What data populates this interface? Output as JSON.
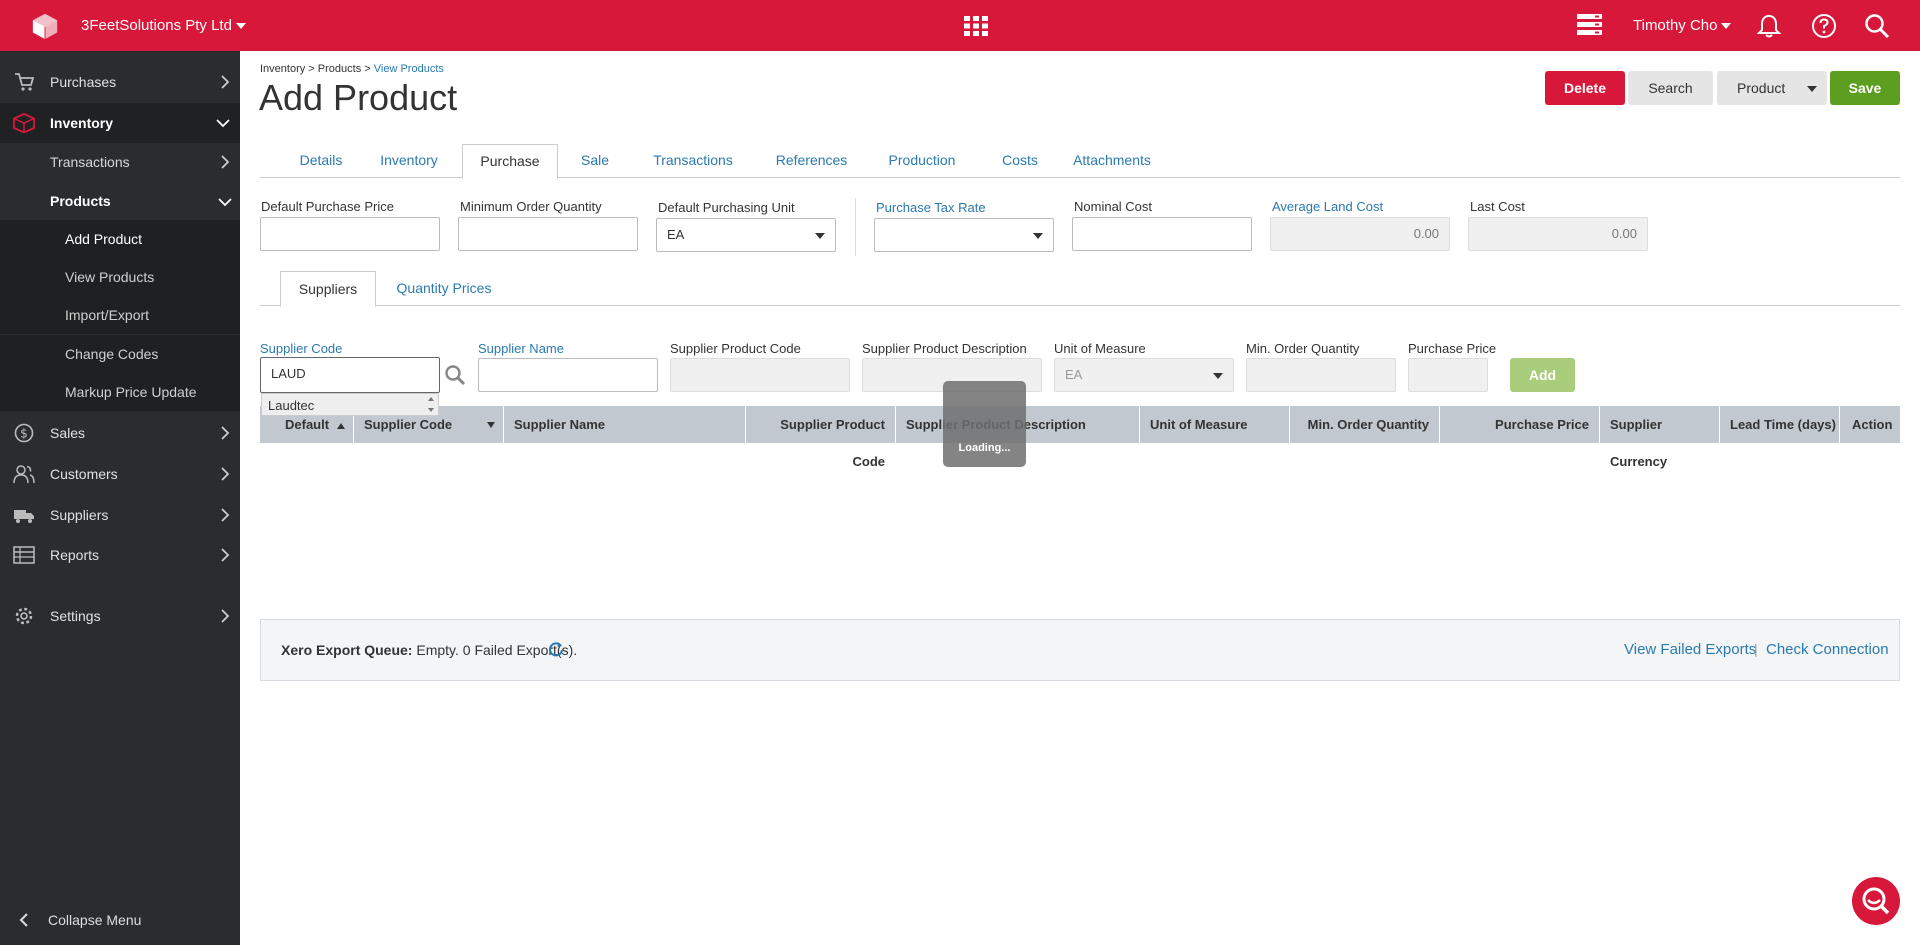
{
  "topbar": {
    "company": "3FeetSolutions Pty Ltd",
    "user": "Timothy Cho"
  },
  "sidebar": {
    "items": [
      {
        "label": "Purchases",
        "icon": "cart-icon"
      },
      {
        "label": "Inventory",
        "icon": "box-icon"
      },
      {
        "label": "Sales",
        "icon": "dollar-icon"
      },
      {
        "label": "Customers",
        "icon": "customers-icon"
      },
      {
        "label": "Suppliers",
        "icon": "truck-icon"
      },
      {
        "label": "Reports",
        "icon": "table-icon"
      },
      {
        "label": "Settings",
        "icon": "gear-icon"
      }
    ],
    "inventory_sub": {
      "transactions": "Transactions",
      "products": "Products"
    },
    "products_sub": {
      "add_product": "Add Product",
      "view_products": "View Products",
      "import_export": "Import/Export",
      "change_codes": "Change Codes",
      "markup_price_update": "Markup Price Update"
    },
    "collapse": "Collapse Menu"
  },
  "breadcrumb": {
    "part1": "Inventory",
    "sep": " > ",
    "part2": "Products",
    "part3": "View Products"
  },
  "page_title": "Add Product",
  "actions": {
    "delete": "Delete",
    "search": "Search",
    "product": "Product",
    "save": "Save"
  },
  "tabs": [
    "Details",
    "Inventory",
    "Purchase",
    "Sale",
    "Transactions",
    "References",
    "Production",
    "Costs",
    "Attachments"
  ],
  "purchase": {
    "default_purchase_price": {
      "label": "Default Purchase Price",
      "value": ""
    },
    "minimum_order_quantity": {
      "label": "Minimum Order Quantity",
      "value": ""
    },
    "default_purchasing_unit": {
      "label": "Default Purchasing Unit",
      "value": "EA"
    },
    "purchase_tax_rate": {
      "label": "Purchase Tax Rate",
      "value": ""
    },
    "nominal_cost": {
      "label": "Nominal Cost",
      "value": ""
    },
    "average_land_cost": {
      "label": "Average Land Cost",
      "value": "0.00"
    },
    "last_cost": {
      "label": "Last Cost",
      "value": "0.00"
    }
  },
  "subtabs": [
    "Suppliers",
    "Quantity Prices"
  ],
  "supplier_form": {
    "supplier_code": {
      "label": "Supplier Code",
      "value": "LAUD"
    },
    "supplier_name": {
      "label": "Supplier Name",
      "value": ""
    },
    "supplier_product_code": {
      "label": "Supplier Product Code",
      "value": ""
    },
    "supplier_product_description": {
      "label": "Supplier Product Description",
      "value": ""
    },
    "unit_of_measure": {
      "label": "Unit of Measure",
      "value": "EA"
    },
    "min_order_quantity": {
      "label": "Min. Order Quantity",
      "value": ""
    },
    "purchase_price": {
      "label": "Purchase Price",
      "value": ""
    },
    "add": "Add"
  },
  "autocomplete": {
    "item": "Laudtec"
  },
  "grid_columns": [
    "Default",
    "Supplier Code",
    "Supplier Name",
    "Supplier Product Code",
    "Supplier Product Description",
    "Unit of Measure",
    "Min. Order Quantity",
    "Purchase Price",
    "Supplier Currency",
    "Lead Time (days)",
    "Action"
  ],
  "loading": "Loading...",
  "xero": {
    "label": "Xero Export Queue:",
    "status": " Empty. 0 Failed Export(s).",
    "view_failed": "View Failed Exports",
    "sep": "|",
    "check_connection": "Check Connection"
  },
  "colors": {
    "brand": "#d7183a",
    "save": "#5c9e1f",
    "link": "#2a7ab0",
    "sidebar": "#2a2d30"
  }
}
